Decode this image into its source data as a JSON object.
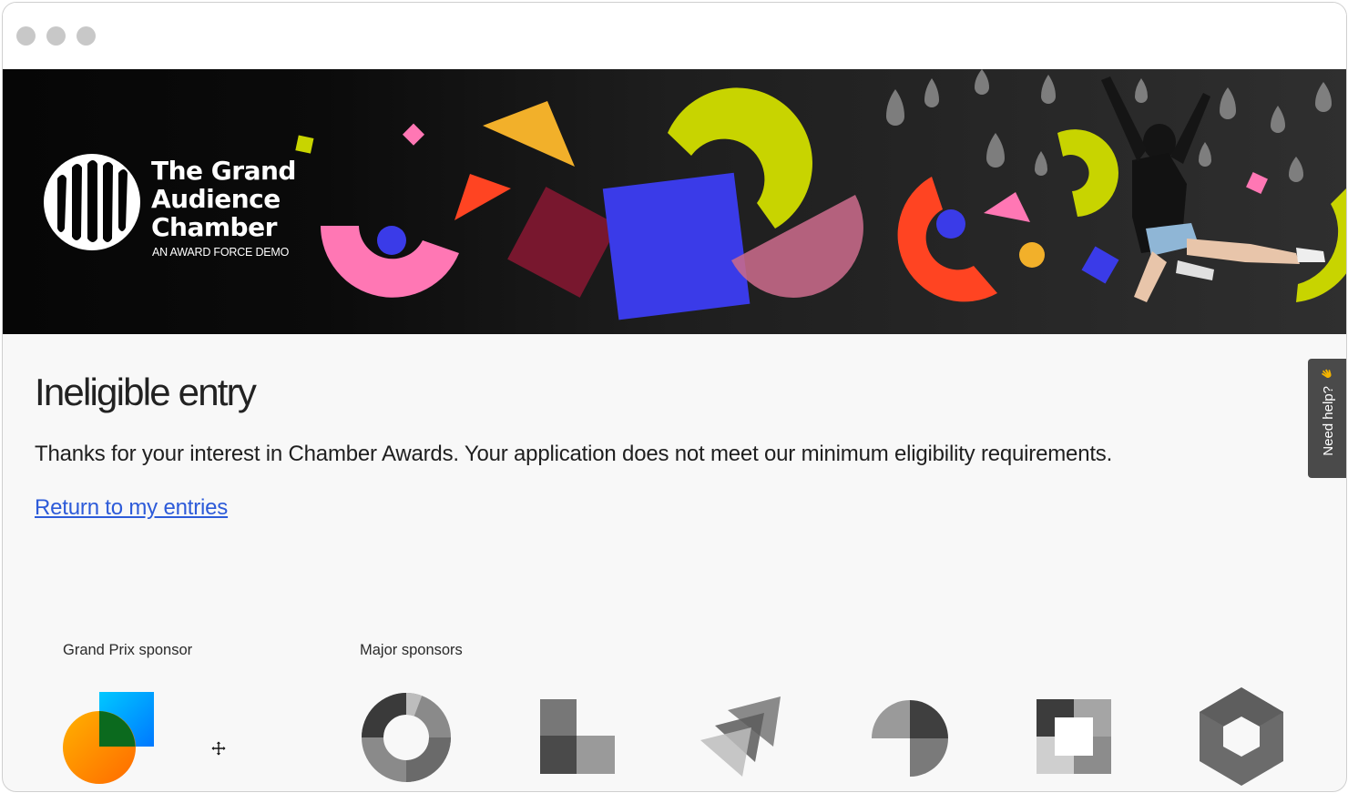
{
  "window": {
    "traffic_lights": [
      "close",
      "minimize",
      "maximize"
    ]
  },
  "banner": {
    "org_name_lines": [
      "The Grand",
      "Audience",
      "Chamber"
    ],
    "org_subtitle": "AN AWARD FORCE DEMO"
  },
  "main": {
    "title": "Ineligible entry",
    "message": "Thanks for your interest in Chamber Awards. Your application does not meet our minimum eligibility requirements.",
    "return_link": "Return to my entries"
  },
  "sponsors": {
    "grand_prix_label": "Grand Prix sponsor",
    "major_label": "Major sponsors",
    "grand_prix_logo": "gradient-circle-square-logo",
    "major_logos": [
      "ring-logo",
      "blocks-logo",
      "arrows-logo",
      "quarter-circles-logo",
      "nested-squares-logo",
      "hexagon-logo"
    ]
  },
  "help": {
    "label": "Need help?",
    "icon": "wave-hand-icon"
  },
  "colors": {
    "link": "#2d5bd9",
    "help_tab_bg": "#4a4a4a",
    "shape_pink": "#ff77b4",
    "shape_blue": "#3a3be8",
    "shape_lime": "#c8d400",
    "shape_orange": "#f2b02a",
    "shape_red": "#ff4422"
  }
}
